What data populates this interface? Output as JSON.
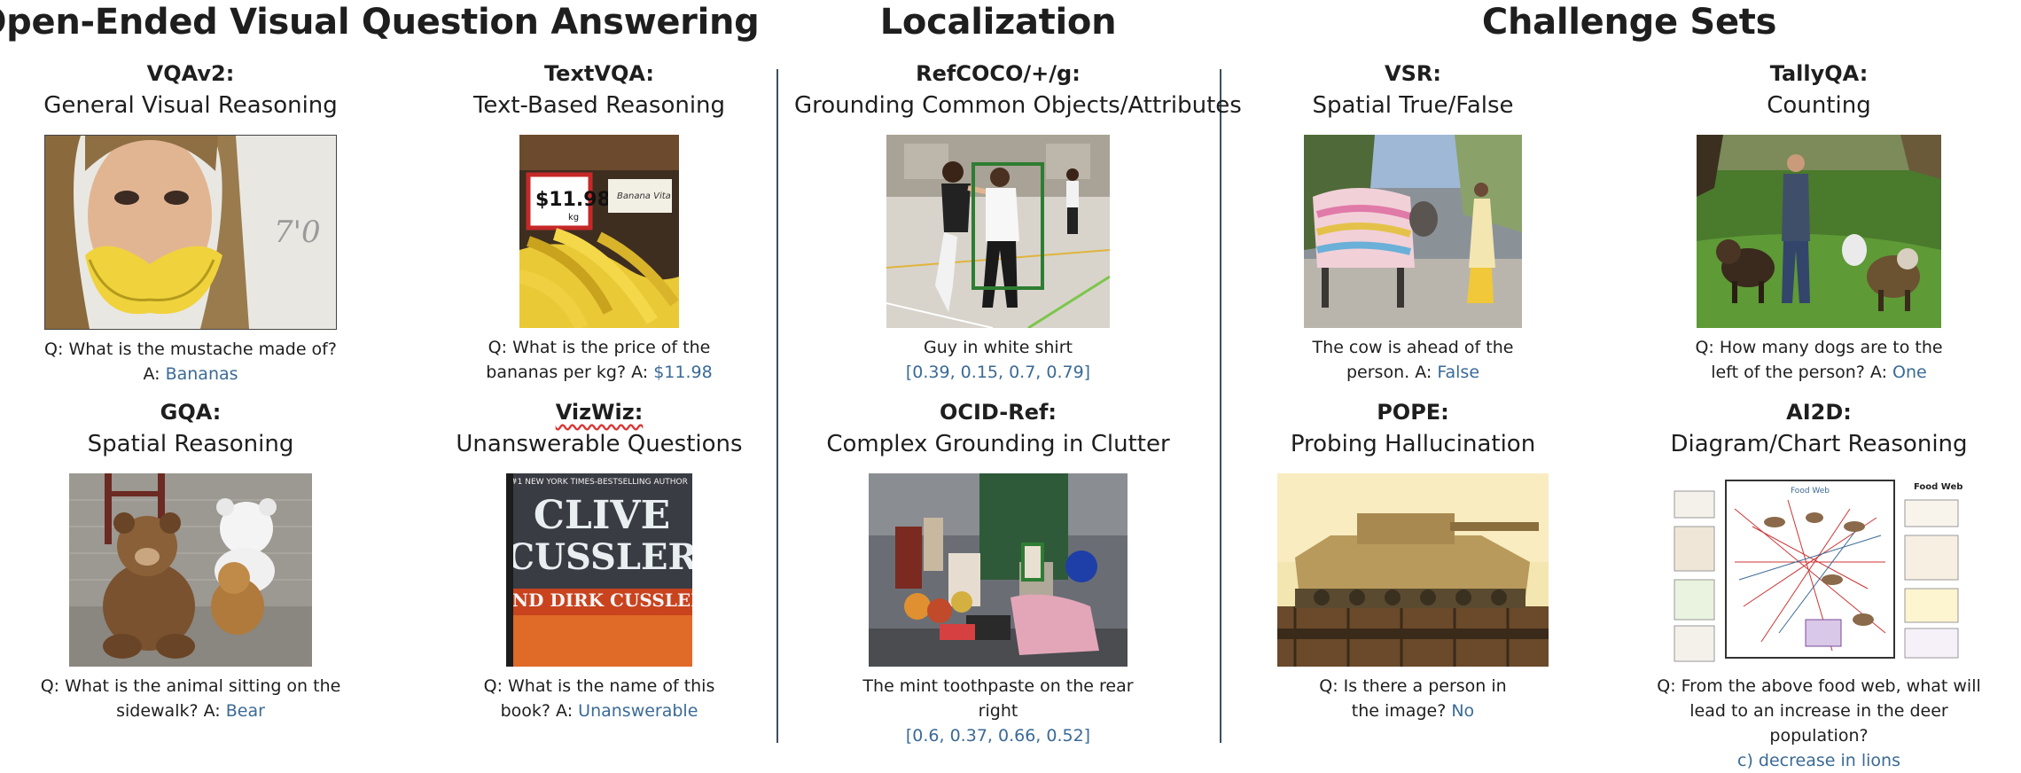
{
  "sections": {
    "open_ended": "Open-Ended Visual Question Answering",
    "localization": "Localization",
    "challenge": "Challenge Sets"
  },
  "cards": {
    "vqav2": {
      "name": "VQAv2:",
      "desc": "General Visual Reasoning",
      "q": "Q: What is the mustache made of? A:",
      "a": "Bananas",
      "img_text": "7'0"
    },
    "textvqa": {
      "name": "TextVQA:",
      "desc": "Text-Based Reasoning",
      "q": "Q: What is the price of the bananas per kg? A:",
      "a": "$11.98",
      "img_price": "$11.98",
      "img_unit": "kg",
      "img_label": "Banana Vita"
    },
    "refcoco": {
      "name": "RefCOCO/+/g:",
      "desc": "Grounding Common Objects/Attributes",
      "q": "Guy in white shirt",
      "a": "[0.39, 0.15, 0.7, 0.79]"
    },
    "vsr": {
      "name": "VSR:",
      "desc": "Spatial True/False",
      "q": "The cow is ahead of the person. A:",
      "a": "False"
    },
    "tallyqa": {
      "name": "TallyQA:",
      "desc": "Counting",
      "q": "Q: How many dogs are to the left of the person? A:",
      "a": "One"
    },
    "gqa": {
      "name": "GQA:",
      "desc": "Spatial Reasoning",
      "q": "Q: What is the animal sitting on the sidewalk? A:",
      "a": "Bear"
    },
    "vizwiz": {
      "name": "VizWiz:",
      "desc": "Unanswerable Questions",
      "q": "Q: What is the name of this book? A:",
      "a": "Unanswerable",
      "img_top": "#1 NEW YORK TIMES-BESTSELLING AUTHOR",
      "img_line1": "CLIVE",
      "img_line2": "CUSSLER",
      "img_line3": "AND DIRK CUSSLER"
    },
    "ocidref": {
      "name": "OCID-Ref:",
      "desc": "Complex Grounding in Clutter",
      "q": "The mint toothpaste on the rear right",
      "a": "[0.6, 0.37, 0.66, 0.52]"
    },
    "pope": {
      "name": "POPE:",
      "desc": "Probing Hallucination",
      "q": "Q: Is there a person in the image?",
      "a": "No"
    },
    "ai2d": {
      "name": "AI2D:",
      "desc": "Diagram/Chart Reasoning",
      "q": "Q: From the above food web, what will lead to an increase in the deer population?",
      "a": "c) decrease in lions",
      "img_title": "Food Web",
      "img_title2": "Food Web"
    }
  },
  "colors": {
    "answer": "#3a6a96",
    "divider": "#3c4f5e",
    "box": "#2e7d32"
  }
}
